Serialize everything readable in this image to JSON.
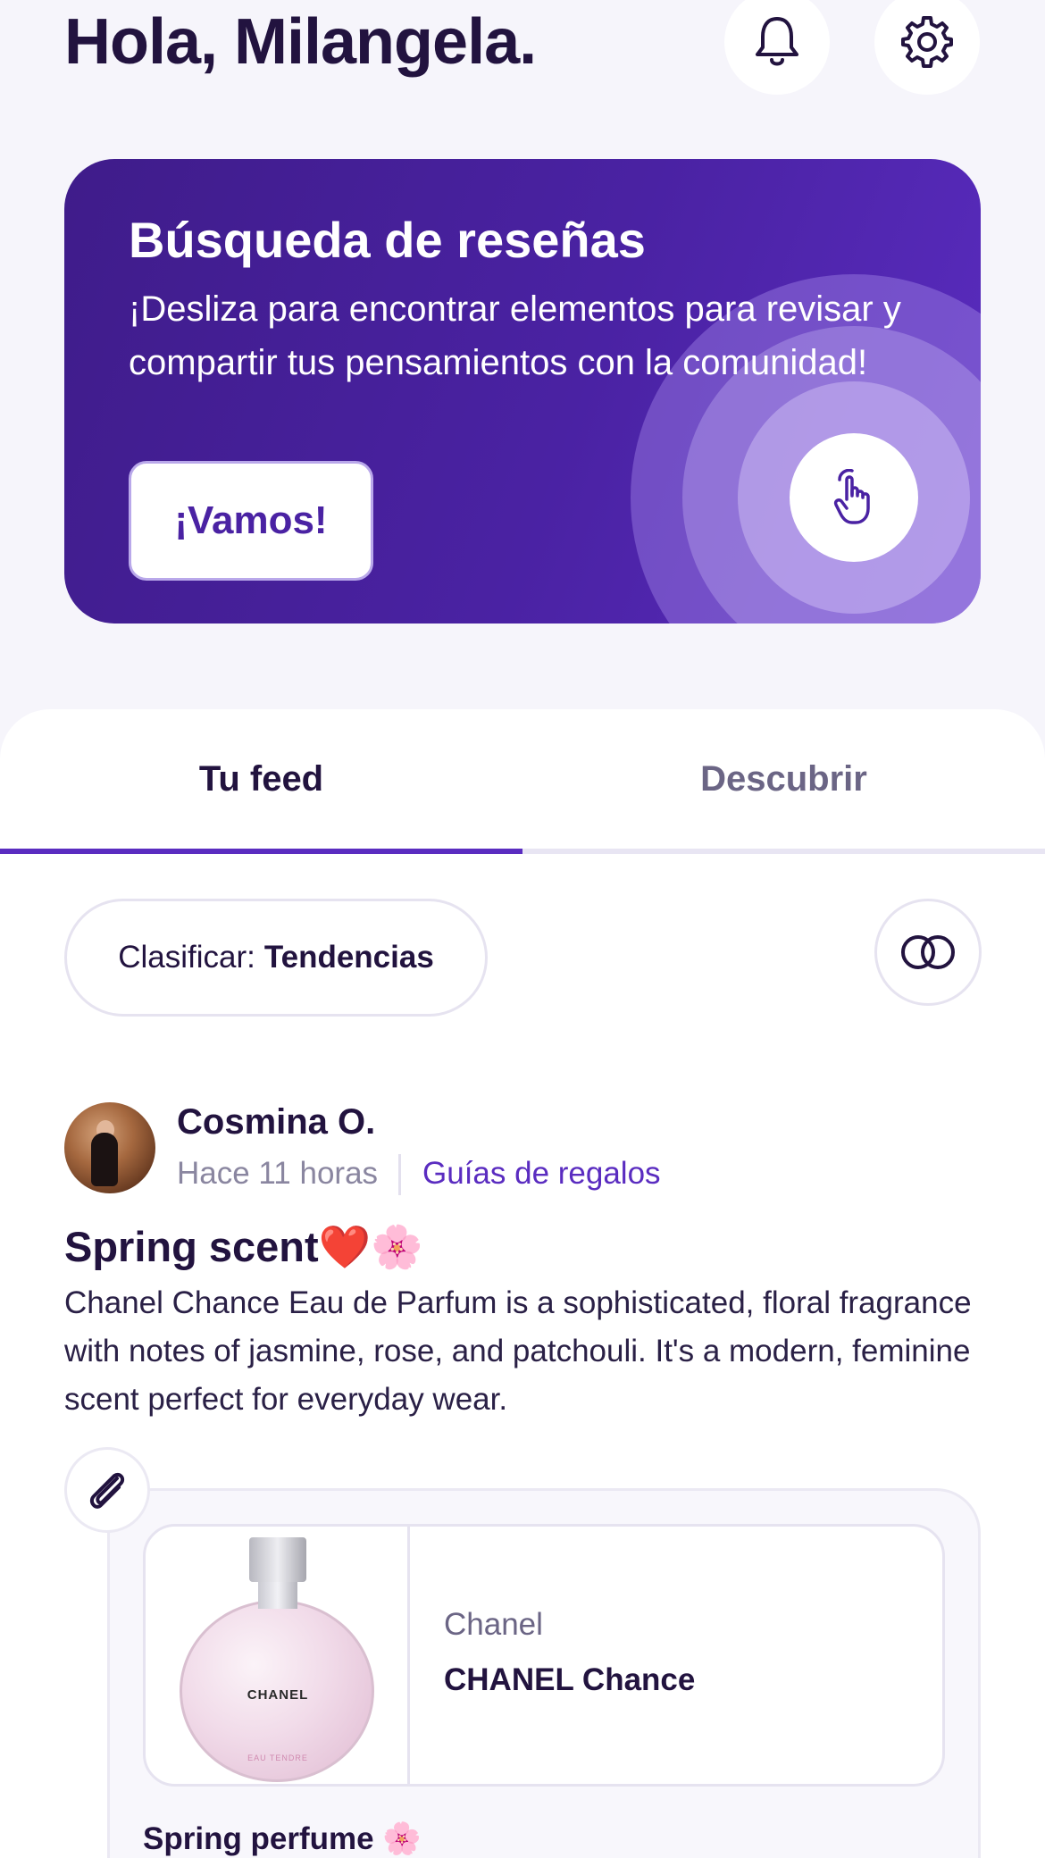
{
  "header": {
    "greeting": "Hola, Milangela."
  },
  "promo": {
    "title": "Búsqueda de reseñas",
    "description": "¡Desliza para encontrar elementos para revisar y compartir tus pensamientos con la comunidad!",
    "cta_label": "¡Vamos!"
  },
  "tabs": [
    {
      "label": "Tu feed",
      "active": true
    },
    {
      "label": "Descubrir",
      "active": false
    }
  ],
  "sort": {
    "prefix": "Clasificar:",
    "value": "Tendencias"
  },
  "post": {
    "author": "Cosmina O.",
    "time": "Hace 11 horas",
    "category": "Guías de regalos",
    "title": "Spring scent❤️🌸",
    "body": "Chanel Chance Eau de Parfum is a sophisticated, floral fragrance with notes of jasmine, rose, and patchouli. It's a modern, feminine scent perfect for everyday wear.",
    "product": {
      "brand": "Chanel",
      "name": "CHANEL Chance",
      "image_label": "CHANEL",
      "image_sublabel": "EAU TENDRE"
    },
    "attachment_caption": "Spring perfume 🌸"
  },
  "colors": {
    "accent": "#5a2cc0",
    "promo_dark": "#3f1c8a",
    "text_primary": "#22133f",
    "text_muted": "#8a86a0"
  },
  "icons": [
    "bell-icon",
    "gear-icon",
    "tap-hand-icon",
    "filter-rings-icon",
    "paperclip-icon"
  ]
}
